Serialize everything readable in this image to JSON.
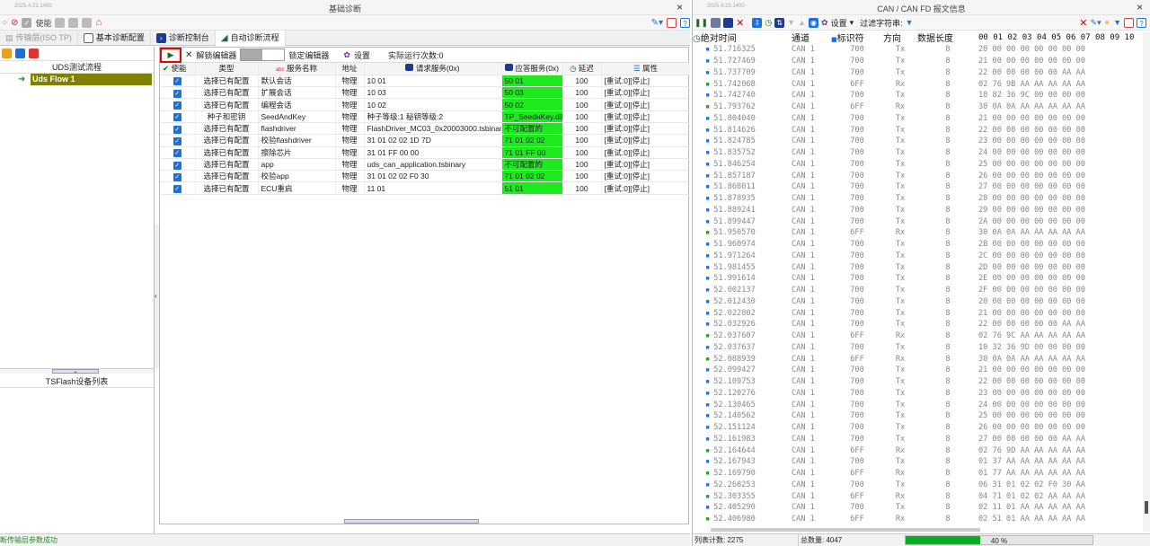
{
  "left": {
    "date": "2025.4.23.1400",
    "title": "基础诊断",
    "toolbar": {
      "enable_label": "使能"
    },
    "tabs": [
      {
        "label": "传输层(ISO TP)",
        "state": "disabled"
      },
      {
        "label": "基本诊断配置",
        "state": "normal"
      },
      {
        "label": "诊断控制台",
        "state": "normal"
      },
      {
        "label": "自动诊断流程",
        "state": "active"
      }
    ],
    "sidebar": {
      "title": "UDS测试流程",
      "flow_item": "Uds Flow 1",
      "device_list_title": "TSFlash设备列表"
    },
    "editor": {
      "unlock_label": "解锁编辑器",
      "lock_label": "锁定编辑器",
      "settings_label": "设置",
      "run_count_label": "实际运行次数:0"
    },
    "grid": {
      "headers": [
        "使能",
        "类型",
        "服务名称",
        "地址",
        "请求服务(0x)",
        "应答服务(0x)",
        "延迟",
        "属性"
      ],
      "rows": [
        {
          "type": "选择已有配置",
          "name": "默认会话",
          "addr": "物理",
          "req": "10 01",
          "resp": "50 01",
          "delay": "100",
          "attr": "[重试:0][停止]"
        },
        {
          "type": "选择已有配置",
          "name": "扩展会话",
          "addr": "物理",
          "req": "10 03",
          "resp": "50 03",
          "delay": "100",
          "attr": "[重试:0][停止]"
        },
        {
          "type": "选择已有配置",
          "name": "编程会话",
          "addr": "物理",
          "req": "10 02",
          "resp": "50 02",
          "delay": "100",
          "attr": "[重试:0][停止]"
        },
        {
          "type": "种子和密钥",
          "name": "SeedAndKey",
          "addr": "物理",
          "req": "种子等级:1 秘钥等级:2",
          "resp": "TP_SeedнKey.dll",
          "delay": "100",
          "attr": "[重试:0][停止]"
        },
        {
          "type": "选择已有配置",
          "name": "flashdriver",
          "addr": "物理",
          "req": "FlashDriver_MC03_0x20003000.tsbinary",
          "resp": "不可配置的",
          "delay": "100",
          "attr": "[重试:0][停止]"
        },
        {
          "type": "选择已有配置",
          "name": "校验flashdriver",
          "addr": "物理",
          "req": "31 01 02 02 1D 7D",
          "resp": "71 01 02 02",
          "delay": "100",
          "attr": "[重试:0][停止]"
        },
        {
          "type": "选择已有配置",
          "name": "擦除芯片",
          "addr": "物理",
          "req": "31 01 FF 00 00",
          "resp": "71 01 FF 00",
          "delay": "100",
          "attr": "[重试:0][停止]"
        },
        {
          "type": "选择已有配置",
          "name": "app",
          "addr": "物理",
          "req": "uds_can_application.tsbinary",
          "resp": "不可配置的",
          "delay": "100",
          "attr": "[重试:0][停止]"
        },
        {
          "type": "选择已有配置",
          "name": "校验app",
          "addr": "物理",
          "req": "31 01 02 02 F0 30",
          "resp": "71 01 02 02",
          "delay": "100",
          "attr": "[重试:0][停止]"
        },
        {
          "type": "选择已有配置",
          "name": "ECU重启",
          "addr": "物理",
          "req": "11 01",
          "resp": "51 01",
          "delay": "100",
          "attr": "[重试:0][停止]"
        }
      ]
    },
    "status_text": "断传输层参数成功"
  },
  "right": {
    "date": "2025.4.23.1400",
    "title": "CAN / CAN FD 报文信息",
    "toolbar": {
      "settings_label": "设置",
      "filter_label": "过滤字符串:"
    },
    "headers": [
      "绝对时间",
      "通道",
      "标识符",
      "方向",
      "数据长度",
      "00 01 02 03 04 05 06 07 08 09 10"
    ],
    "rows": [
      [
        "51.716325",
        "CAN 1",
        "700",
        "Tx",
        "8",
        "20 00 00 00 00 00 00 00"
      ],
      [
        "51.727469",
        "CAN 1",
        "700",
        "Tx",
        "8",
        "21 00 00 00 00 00 00 00"
      ],
      [
        "51.737709",
        "CAN 1",
        "700",
        "Tx",
        "8",
        "22 00 00 00 00 00 AA AA"
      ],
      [
        "51.742068",
        "CAN 1",
        "6FF",
        "Rx",
        "8",
        "02 76 9B AA AA AA AA AA"
      ],
      [
        "51.742740",
        "CAN 1",
        "700",
        "Tx",
        "8",
        "10 82 36 9C 00 00 00 00"
      ],
      [
        "51.793762",
        "CAN 1",
        "6FF",
        "Rx",
        "8",
        "30 0A 0A AA AA AA AA AA"
      ],
      [
        "51.804040",
        "CAN 1",
        "700",
        "Tx",
        "8",
        "21 00 00 00 00 00 00 00"
      ],
      [
        "51.814626",
        "CAN 1",
        "700",
        "Tx",
        "8",
        "22 00 00 00 00 00 00 00"
      ],
      [
        "51.824785",
        "CAN 1",
        "700",
        "Tx",
        "8",
        "23 00 00 00 00 00 00 00"
      ],
      [
        "51.835752",
        "CAN 1",
        "700",
        "Tx",
        "8",
        "24 00 00 00 00 00 00 00"
      ],
      [
        "51.846254",
        "CAN 1",
        "700",
        "Tx",
        "8",
        "25 00 00 00 00 00 00 00"
      ],
      [
        "51.857187",
        "CAN 1",
        "700",
        "Tx",
        "8",
        "26 00 00 00 00 00 00 00"
      ],
      [
        "51.868011",
        "CAN 1",
        "700",
        "Tx",
        "8",
        "27 00 00 00 00 00 00 00"
      ],
      [
        "51.878935",
        "CAN 1",
        "700",
        "Tx",
        "8",
        "28 00 00 00 00 00 00 00"
      ],
      [
        "51.889241",
        "CAN 1",
        "700",
        "Tx",
        "8",
        "29 00 00 00 00 00 00 00"
      ],
      [
        "51.899447",
        "CAN 1",
        "700",
        "Tx",
        "8",
        "2A 00 00 00 00 00 00 00"
      ],
      [
        "51.950570",
        "CAN 1",
        "6FF",
        "Rx",
        "8",
        "30 0A 0A AA AA AA AA AA"
      ],
      [
        "51.960974",
        "CAN 1",
        "700",
        "Tx",
        "8",
        "2B 00 00 00 00 00 00 00"
      ],
      [
        "51.971264",
        "CAN 1",
        "700",
        "Tx",
        "8",
        "2C 00 00 00 00 00 00 00"
      ],
      [
        "51.981455",
        "CAN 1",
        "700",
        "Tx",
        "8",
        "2D 00 00 00 00 00 00 00"
      ],
      [
        "51.991614",
        "CAN 1",
        "700",
        "Tx",
        "8",
        "2E 00 00 00 00 00 00 00"
      ],
      [
        "52.002137",
        "CAN 1",
        "700",
        "Tx",
        "8",
        "2F 00 00 00 00 00 00 00"
      ],
      [
        "52.012430",
        "CAN 1",
        "700",
        "Tx",
        "8",
        "20 00 00 00 00 00 00 00"
      ],
      [
        "52.022802",
        "CAN 1",
        "700",
        "Tx",
        "8",
        "21 00 00 00 00 00 00 00"
      ],
      [
        "52.032926",
        "CAN 1",
        "700",
        "Tx",
        "8",
        "22 00 00 00 00 00 AA AA"
      ],
      [
        "52.037607",
        "CAN 1",
        "6FF",
        "Rx",
        "8",
        "02 76 9C AA AA AA AA AA"
      ],
      [
        "52.037637",
        "CAN 1",
        "700",
        "Tx",
        "8",
        "10 32 36 9D 00 00 00 00"
      ],
      [
        "52.088939",
        "CAN 1",
        "6FF",
        "Rx",
        "8",
        "30 0A 0A AA AA AA AA AA"
      ],
      [
        "52.099427",
        "CAN 1",
        "700",
        "Tx",
        "8",
        "21 00 00 00 00 00 00 00"
      ],
      [
        "52.109753",
        "CAN 1",
        "700",
        "Tx",
        "8",
        "22 00 00 00 00 00 00 00"
      ],
      [
        "52.120276",
        "CAN 1",
        "700",
        "Tx",
        "8",
        "23 00 00 00 00 00 00 00"
      ],
      [
        "52.130465",
        "CAN 1",
        "700",
        "Tx",
        "8",
        "24 00 00 00 00 00 00 00"
      ],
      [
        "52.140562",
        "CAN 1",
        "700",
        "Tx",
        "8",
        "25 00 00 00 00 00 00 00"
      ],
      [
        "52.151124",
        "CAN 1",
        "700",
        "Tx",
        "8",
        "26 00 00 00 00 00 00 00"
      ],
      [
        "52.161983",
        "CAN 1",
        "700",
        "Tx",
        "8",
        "27 00 00 00 00 00 AA AA"
      ],
      [
        "52.164644",
        "CAN 1",
        "6FF",
        "Rx",
        "8",
        "02 76 9D AA AA AA AA AA"
      ],
      [
        "52.167943",
        "CAN 1",
        "700",
        "Tx",
        "8",
        "01 37 AA AA AA AA AA AA"
      ],
      [
        "52.169790",
        "CAN 1",
        "6FF",
        "Rx",
        "8",
        "01 77 AA AA AA AA AA AA"
      ],
      [
        "52.268253",
        "CAN 1",
        "700",
        "Tx",
        "8",
        "06 31 01 02 02 F0 30 AA"
      ],
      [
        "52.303355",
        "CAN 1",
        "6FF",
        "Rx",
        "8",
        "04 71 01 02 02 AA AA AA"
      ],
      [
        "52.405290",
        "CAN 1",
        "700",
        "Tx",
        "8",
        "02 11 01 AA AA AA AA AA"
      ],
      [
        "52.406980",
        "CAN 1",
        "6FF",
        "Rx",
        "8",
        "02 51 01 AA AA AA AA AA"
      ]
    ],
    "status": {
      "list_count": "列表计数: 2275",
      "total": "总数量: 4047",
      "progress_text": "40 %",
      "progress": 0.4
    }
  },
  "colors": {
    "green": "#1ee81e",
    "accent": "#1e6fd9",
    "olive": "#808000"
  }
}
